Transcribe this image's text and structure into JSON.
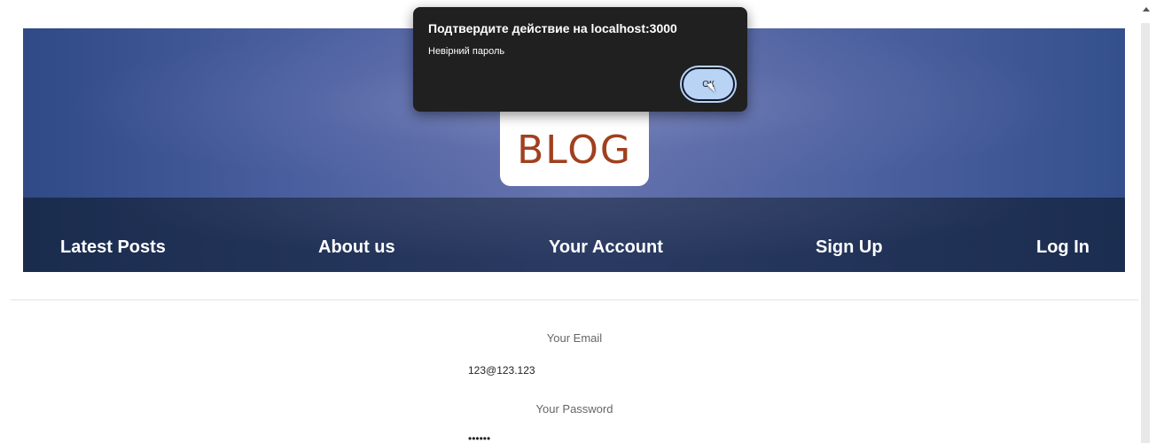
{
  "header": {
    "logo_text": "BLOG"
  },
  "nav": {
    "items": [
      {
        "label": "Latest Posts"
      },
      {
        "label": "About us"
      },
      {
        "label": "Your Account"
      },
      {
        "label": "Sign Up"
      },
      {
        "label": "Log In"
      }
    ]
  },
  "form": {
    "email_label": "Your Email",
    "email_value": "123@123.123",
    "password_label": "Your Password",
    "password_value": "••••••"
  },
  "dialog": {
    "title": "Подтвердите действие на localhost:3000",
    "message": "Невірний пароль",
    "ok_label": "ОК"
  },
  "colors": {
    "brand": "#a0401e",
    "nav_bg": "#1a2c4e",
    "dialog_bg": "#202020",
    "ok_button": "#b9d3f5"
  }
}
